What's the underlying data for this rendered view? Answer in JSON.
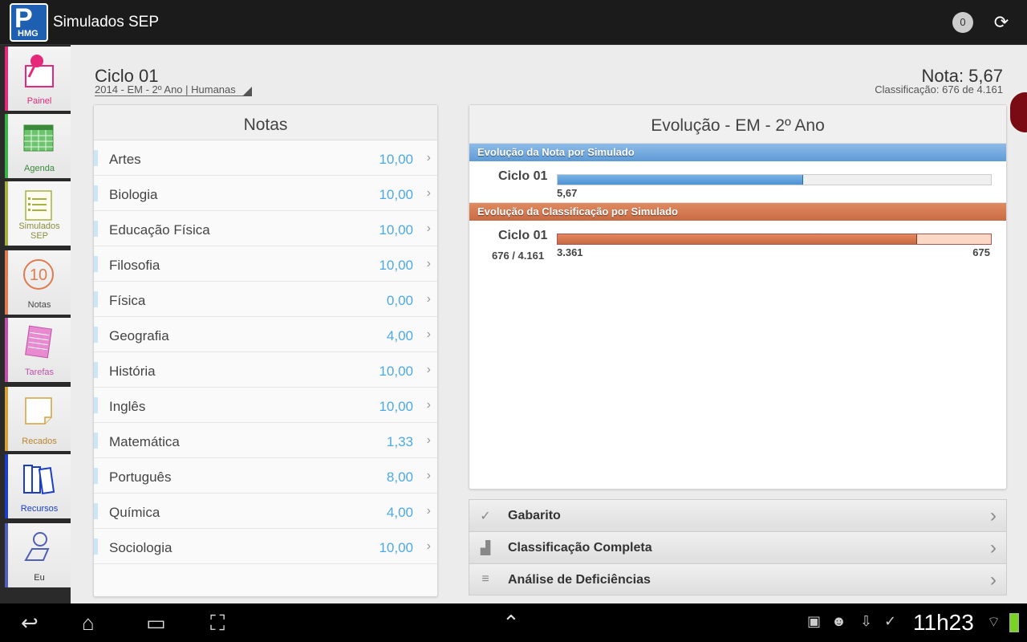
{
  "app": {
    "logo_letter": "P",
    "logo_sub": "HMG",
    "title": "Simulados SEP",
    "badge_count": "0"
  },
  "nav": [
    {
      "label": "Painel",
      "color": "#e6287a"
    },
    {
      "label": "Agenda",
      "color": "#3bb14a"
    },
    {
      "label": "Simulados SEP",
      "color": "#a8b043"
    },
    {
      "label": "Notas",
      "color": "#e07b4f"
    },
    {
      "label": "Tarefas",
      "color": "#c050a8"
    },
    {
      "label": "Recados",
      "color": "#d4a23a"
    },
    {
      "label": "Recursos",
      "color": "#1a3ec8"
    },
    {
      "label": "Eu",
      "color": "#5060b8"
    }
  ],
  "header": {
    "cycle_title": "Ciclo 01",
    "cycle_sub": "2014 - EM - 2º Ano | Humanas",
    "nota": "Nota: 5,67",
    "classificacao": "Classificação: 676 de 4.161"
  },
  "notas": {
    "title": "Notas",
    "rows": [
      {
        "subject": "Artes",
        "value": "10,00"
      },
      {
        "subject": "Biologia",
        "value": "10,00"
      },
      {
        "subject": "Educação Física",
        "value": "10,00"
      },
      {
        "subject": "Filosofia",
        "value": "10,00"
      },
      {
        "subject": "Física",
        "value": "0,00"
      },
      {
        "subject": "Geografia",
        "value": "4,00"
      },
      {
        "subject": "História",
        "value": "10,00"
      },
      {
        "subject": "Inglês",
        "value": "10,00"
      },
      {
        "subject": "Matemática",
        "value": "1,33"
      },
      {
        "subject": "Português",
        "value": "8,00"
      },
      {
        "subject": "Química",
        "value": "4,00"
      },
      {
        "subject": "Sociologia",
        "value": "10,00"
      }
    ]
  },
  "evolucao": {
    "title": "Evolução - EM - 2º Ano",
    "nota_header": "Evolução da Nota por Simulado",
    "nota_row": {
      "label": "Ciclo 01",
      "value_text": "5,67",
      "fraction": 0.567
    },
    "classif_header": "Evolução da Classificação por Simulado",
    "classif_row": {
      "label": "Ciclo 01",
      "sub": "676 / 4.161",
      "left_tick": "3.361",
      "right_tick": "675",
      "fraction": 0.83
    }
  },
  "actions": [
    {
      "label": "Gabarito",
      "icon": "check-x-icon"
    },
    {
      "label": "Classificação Completa",
      "icon": "podium-icon"
    },
    {
      "label": "Análise de Deficiências",
      "icon": "bars-icon"
    }
  ],
  "system": {
    "clock": "11h23"
  }
}
